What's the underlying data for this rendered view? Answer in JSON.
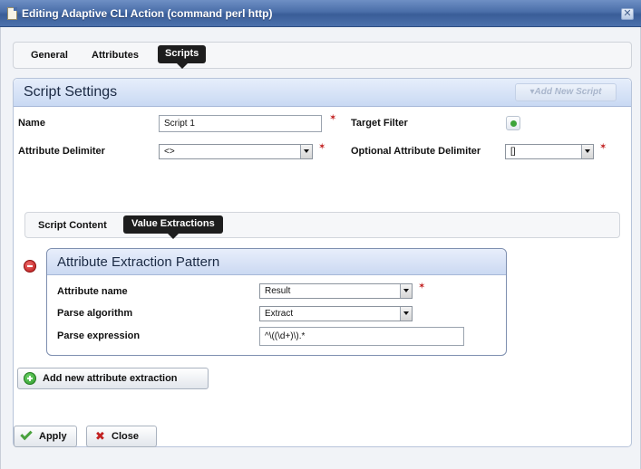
{
  "window": {
    "title": "Editing Adaptive CLI Action (command perl http)",
    "close_glyph": "✕"
  },
  "tabs": [
    {
      "label": "General",
      "active": false
    },
    {
      "label": "Attributes",
      "active": false
    },
    {
      "label": "Scripts",
      "active": true
    }
  ],
  "script_settings": {
    "title": "Script Settings",
    "add_script_label": "▾Add New Script",
    "name_label": "Name",
    "name_value": "Script 1",
    "target_filter_label": "Target Filter",
    "attribute_delimiter_label": "Attribute Delimiter",
    "attribute_delimiter_value": "<>",
    "optional_delimiter_label": "Optional Attribute Delimiter",
    "optional_delimiter_value": "[]"
  },
  "sub_tabs": [
    {
      "label": "Script Content",
      "active": false
    },
    {
      "label": "Value Extractions",
      "active": true
    }
  ],
  "extraction": {
    "title": "Attribute Extraction Pattern",
    "attribute_name_label": "Attribute name",
    "attribute_name_value": "Result",
    "parse_algorithm_label": "Parse algorithm",
    "parse_algorithm_value": "Extract",
    "parse_expression_label": "Parse expression",
    "parse_expression_value": "^\\((\\d+)\\).*"
  },
  "add_extraction_label": "Add new attribute extraction",
  "footer": {
    "apply_label": "Apply",
    "close_label": "Close",
    "close_glyph": "✖"
  },
  "colors": {
    "title_bar": "#4a6ea9",
    "panel_header": "#c9d9f3",
    "required_marker": "#c12020",
    "add_icon": "#3ea43a",
    "remove_icon": "#b81818"
  },
  "icons": {
    "window": "document-icon",
    "close": "close-icon",
    "required": "required-asterisk-icon",
    "target_filter": "add-filter-icon",
    "remove": "remove-icon",
    "add": "add-icon",
    "apply": "checkmark-icon",
    "close_dialog": "x-icon"
  }
}
